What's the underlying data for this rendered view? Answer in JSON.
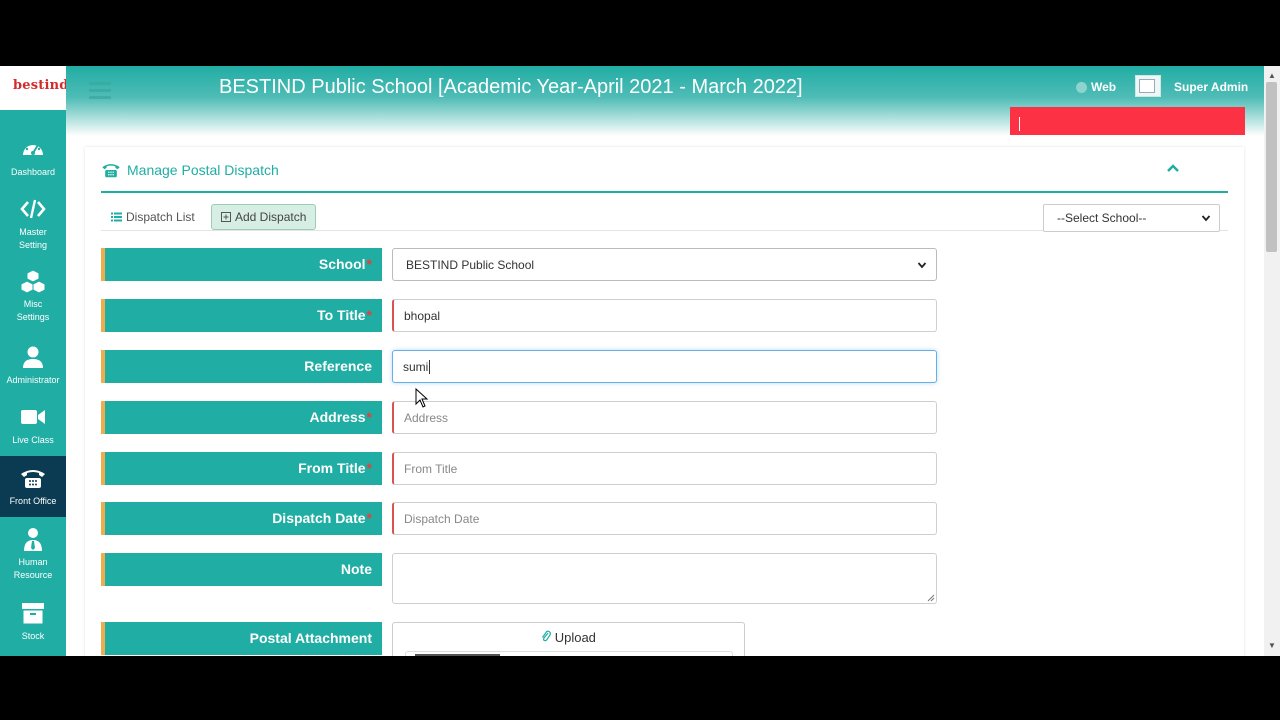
{
  "sidebar": {
    "logo": "bestind",
    "items": [
      {
        "label": "Dashboard",
        "icon": "dashboard-icon"
      },
      {
        "label": "Master Setting",
        "icon": "code-icon"
      },
      {
        "label": "Misc Settings",
        "icon": "cubes-icon"
      },
      {
        "label": "Administrator",
        "icon": "user-icon"
      },
      {
        "label": "Live Class",
        "icon": "video-camera-icon"
      },
      {
        "label": "Front Office",
        "icon": "telephone-icon",
        "active": true
      },
      {
        "label": "Human Resource",
        "icon": "user-tie-icon"
      },
      {
        "label": "Stock",
        "icon": "archive-icon"
      }
    ]
  },
  "header": {
    "title": "BESTIND Public School [Academic Year-April 2021 - March 2022]",
    "web_label": "Web",
    "admin_name": "Super Admin",
    "alert_color": "#fc3244"
  },
  "panel": {
    "title": "Manage Postal Dispatch",
    "tabs": [
      {
        "label": "Dispatch List",
        "icon": "list-icon"
      },
      {
        "label": "Add Dispatch",
        "icon": "plus-square-icon",
        "active": true
      }
    ],
    "school_filter": "--Select School--"
  },
  "form": {
    "school": {
      "label": "School",
      "required": "*",
      "value": "BESTIND Public School"
    },
    "to_title": {
      "label": "To Title",
      "required": "*",
      "value": "bhopal"
    },
    "reference": {
      "label": "Reference",
      "value": "sumi"
    },
    "address": {
      "label": "Address",
      "required": "*",
      "placeholder": "Address"
    },
    "from_title": {
      "label": "From Title",
      "required": "*",
      "placeholder": "From Title"
    },
    "dispatch_date": {
      "label": "Dispatch Date",
      "required": "*",
      "placeholder": "Dispatch Date"
    },
    "note": {
      "label": "Note",
      "value": ""
    },
    "attachment": {
      "label": "Postal Attachment",
      "upload_label": "Upload"
    }
  },
  "colors": {
    "accent": "#20ada4",
    "label_border": "#f0ad4e",
    "required": "#e0433a",
    "active_nav": "#0b3b52"
  }
}
